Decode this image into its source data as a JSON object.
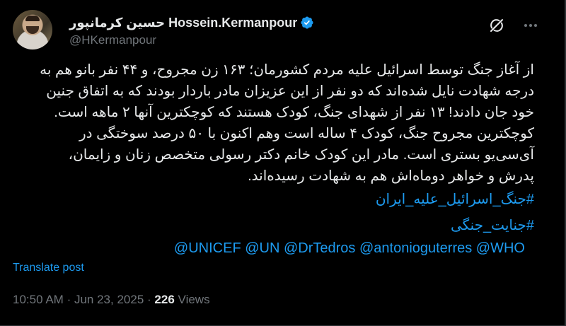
{
  "author": {
    "display_name": "حسین کرمانپور Hossein.Kermanpour",
    "handle": "@HKermanpour",
    "verified": true,
    "verified_color": "#1d9bf0"
  },
  "tweet": {
    "lines": [
      "از آغاز جنگ توسط اسرائیل علیه مردم کشورمان؛ ۱۶۳ زن مجروح، و ۴۴ نفر بانو هم به",
      "درجه شهادت نایل شده‌اند که دو نفر از این عزیزان مادر باردار بودند که به اتفاق جنین",
      "خود جان دادند! ۱۳ نفر از شهدای جنگ، کودک هستند که کوچکترین آنها ۲ ماهه است.",
      "کوچکترین مجروح جنگ، کودک ۴ ساله است وهم اکنون با ۵۰ درصد سوختگی در",
      "آی‌سی‌یو بستری است. مادر این کودک خانم دکتر رسولی متخصص زنان و زایمان،",
      "پدرش و خواهر دوماه‌اش هم به شهادت رسیده‌اند."
    ],
    "hashtags": [
      "#جنگ_اسرائیل_علیه_ایران",
      "#جنایت_جنگی"
    ],
    "mentions": "@UNICEF @UN @DrTedros @antonioguterres @WHO"
  },
  "translate_label": "Translate post",
  "meta": {
    "time": "10:50 AM",
    "separator": "·",
    "date": "Jun 23, 2025",
    "views_count": "226",
    "views_label": "Views"
  },
  "icons": {
    "grok": "grok-icon",
    "more": "more-icon",
    "verified": "verified-badge-icon"
  },
  "colors": {
    "background": "#000000",
    "text": "#e7e9ea",
    "secondary": "#71767b",
    "link": "#1d9bf0"
  }
}
